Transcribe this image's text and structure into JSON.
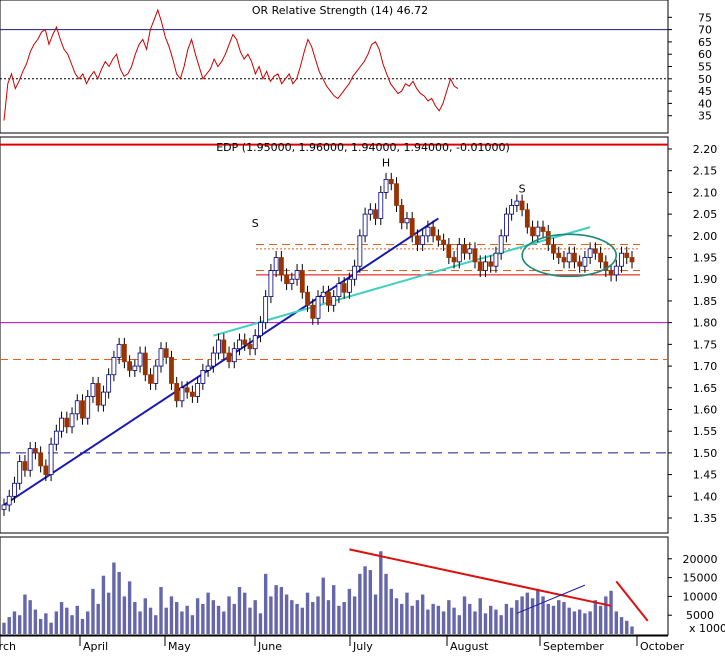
{
  "chart_data": [
    {
      "type": "line",
      "panel": "indicator",
      "title": "OR Relative Strength (14) 46.72",
      "ylim": [
        30,
        80
      ],
      "y_ticks": [
        35,
        40,
        45,
        50,
        55,
        60,
        65,
        70,
        75
      ],
      "reference_lines": [
        {
          "value": 70,
          "style": "solid",
          "color": "#1a1a8c"
        },
        {
          "value": 50,
          "style": "dotted",
          "color": "#000000"
        }
      ],
      "series": [
        {
          "color": "#cc0000",
          "values": [
            33,
            48,
            52,
            46,
            49,
            53,
            56,
            61,
            64,
            66,
            69,
            70,
            64,
            68,
            71,
            66,
            62,
            60,
            56,
            52,
            50,
            52,
            48,
            51,
            53,
            50,
            54,
            57,
            55,
            58,
            60,
            54,
            51,
            52,
            55,
            60,
            64,
            66,
            62,
            70,
            74,
            78,
            73,
            67,
            63,
            58,
            52,
            50,
            55,
            62,
            66,
            60,
            55,
            50,
            52,
            54,
            58,
            55,
            57,
            60,
            64,
            68,
            66,
            61,
            58,
            60,
            57,
            52,
            55,
            50,
            53,
            49,
            51,
            52,
            48,
            50,
            52,
            48,
            50,
            55,
            61,
            66,
            63,
            58,
            53,
            50,
            47,
            45,
            43,
            42,
            44,
            46,
            48,
            51,
            53,
            55,
            57,
            60,
            64,
            65,
            62,
            56,
            52,
            48,
            46,
            44,
            45,
            48,
            47,
            49,
            46,
            44,
            43,
            41,
            42,
            39,
            37,
            40,
            45,
            50,
            47,
            46
          ]
        }
      ]
    },
    {
      "type": "candlestick",
      "panel": "price",
      "title": "EDP (1.95000, 1.96000, 1.94000, 1.94000, -0.01000)",
      "ylim": [
        1.32,
        2.22
      ],
      "y_ticks": [
        "1.35",
        "1.40",
        "1.45",
        "1.50",
        "1.55",
        "1.60",
        "1.65",
        "1.70",
        "1.75",
        "1.80",
        "1.85",
        "1.90",
        "1.95",
        "2.00",
        "2.05",
        "2.10",
        "2.15",
        "2.20"
      ],
      "x_ticks": [
        "March",
        "April",
        "May",
        "June",
        "July",
        "August",
        "September",
        "October"
      ],
      "annotations": [
        {
          "text": "S",
          "x": "June",
          "y": 2.02
        },
        {
          "text": "H",
          "x": "July",
          "y": 2.16
        },
        {
          "text": "S",
          "x": "August",
          "y": 2.1
        }
      ],
      "horizontal_lines": [
        {
          "value": 2.21,
          "style": "solid",
          "color": "#dd0000"
        },
        {
          "value": 1.8,
          "style": "solid",
          "color": "#cc00cc"
        },
        {
          "value": 1.715,
          "style": "dashed",
          "color": "#e06020"
        },
        {
          "value": 1.5,
          "style": "dashed",
          "color": "#1a1a8c"
        },
        {
          "value": 1.98,
          "style": "dashed",
          "color": "#e06020"
        },
        {
          "value": 1.97,
          "style": "dotted",
          "color": "#e06020"
        },
        {
          "value": 1.92,
          "style": "dashed",
          "color": "#e06020"
        },
        {
          "value": 1.91,
          "style": "solid",
          "color": "#dd0000"
        }
      ],
      "series": [
        {
          "name": "",
          "close": [
            1.38,
            1.4,
            1.43,
            1.48,
            1.46,
            1.51,
            1.5,
            1.47,
            1.45,
            1.52,
            1.55,
            1.58,
            1.56,
            1.59,
            1.62,
            1.58,
            1.63,
            1.66,
            1.61,
            1.64,
            1.68,
            1.72,
            1.75,
            1.71,
            1.69,
            1.7,
            1.73,
            1.68,
            1.66,
            1.7,
            1.74,
            1.72,
            1.66,
            1.62,
            1.65,
            1.64,
            1.63,
            1.66,
            1.69,
            1.7,
            1.73,
            1.76,
            1.73,
            1.71,
            1.74,
            1.76,
            1.75,
            1.74,
            1.77,
            1.8,
            1.86,
            1.92,
            1.95,
            1.91,
            1.89,
            1.9,
            1.92,
            1.87,
            1.84,
            1.81,
            1.86,
            1.87,
            1.84,
            1.86,
            1.89,
            1.87,
            1.9,
            1.93,
            2.0,
            2.05,
            2.06,
            2.04,
            2.1,
            2.13,
            2.12,
            2.07,
            2.03,
            2.04,
            2.0,
            1.98,
            2.0,
            2.02,
            2.0,
            1.99,
            1.98,
            1.95,
            1.94,
            1.98,
            1.96,
            1.97,
            1.94,
            1.92,
            1.94,
            1.93,
            1.96,
            2.0,
            2.05,
            2.07,
            2.08,
            2.06,
            2.02,
            2.0,
            2.02,
            2.01,
            1.98,
            1.96,
            1.95,
            1.94,
            1.96,
            1.94,
            1.93,
            1.95,
            1.97,
            1.96,
            1.94,
            1.92,
            1.91,
            1.93,
            1.96,
            1.95,
            1.94
          ]
        }
      ],
      "overlay_shape": {
        "type": "ellipse",
        "color": "#1a8a7a",
        "x_center": "September",
        "y_center": 1.95
      }
    },
    {
      "type": "bar",
      "panel": "volume",
      "ylim": [
        0,
        25000
      ],
      "y_ticks": [
        "20000",
        "15000",
        "10000",
        "5000"
      ],
      "unit_label": "x 1000",
      "series": [
        {
          "values": [
            3000,
            4500,
            6000,
            5000,
            10500,
            9000,
            6500,
            4000,
            5500,
            3000,
            6000,
            8500,
            7000,
            5000,
            7500,
            4000,
            6000,
            12000,
            8000,
            15500,
            11000,
            19000,
            16500,
            10000,
            14000,
            8500,
            6000,
            9500,
            7000,
            5000,
            12500,
            7000,
            10000,
            8500,
            6000,
            7500,
            5000,
            9500,
            8000,
            11000,
            9000,
            7500,
            6000,
            10000,
            8000,
            12500,
            11000,
            7000,
            9000,
            5500,
            16000,
            10000,
            13000,
            12500,
            10500,
            9000,
            8000,
            7000,
            11000,
            8500,
            10000,
            15000,
            9000,
            13000,
            7500,
            8500,
            12000,
            10000,
            16000,
            18000,
            17000,
            10500,
            22000,
            16000,
            12000,
            9500,
            8000,
            11000,
            7500,
            9000,
            10500,
            6500,
            8000,
            7500,
            6000,
            9000,
            7000,
            5000,
            10000,
            8000,
            6000,
            9500,
            5500,
            7500,
            6500,
            5000,
            8000,
            7000,
            9000,
            10000,
            11000,
            9500,
            12000,
            10000,
            8000,
            7500,
            9000,
            8500,
            7000,
            6000,
            6500,
            5500,
            6000,
            9000,
            7500,
            10000,
            11500,
            6000,
            4500,
            3500,
            2000
          ]
        }
      ]
    }
  ]
}
